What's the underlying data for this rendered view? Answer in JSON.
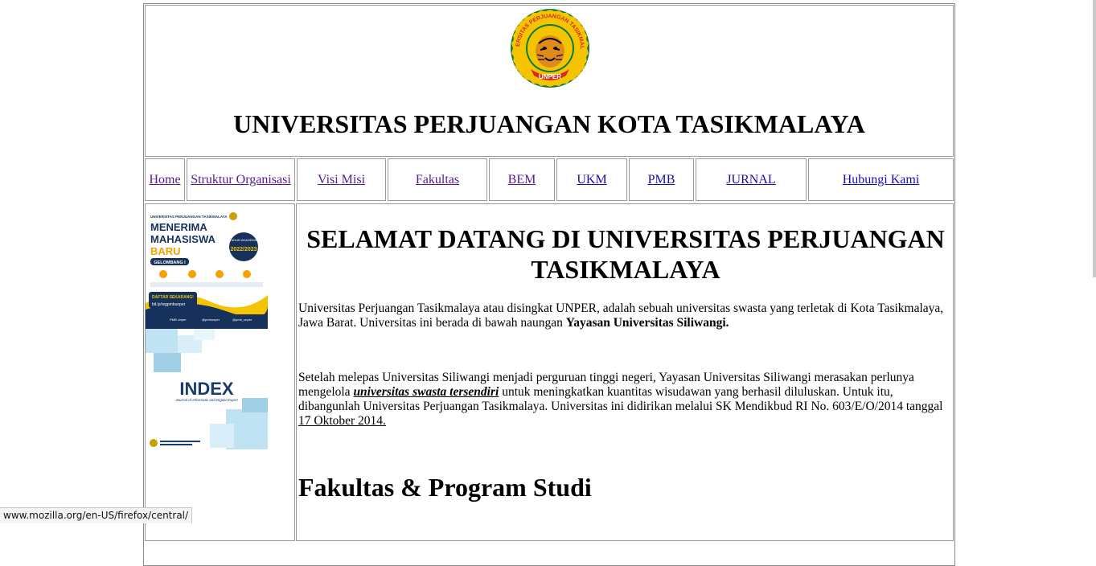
{
  "header": {
    "title": "UNIVERSITAS PERJUANGAN KOTA TASIKMALAYA",
    "logo": {
      "ring_text": "UNIVERSITAS PERJUANGAN TASIKMALAYA",
      "ribbon_text": "UNPER"
    }
  },
  "nav": {
    "items": [
      {
        "label": "Home"
      },
      {
        "label": "Struktur Organisasi"
      },
      {
        "label": "Visi Misi"
      },
      {
        "label": "Fakultas"
      },
      {
        "label": "BEM"
      },
      {
        "label": "UKM"
      },
      {
        "label": "PMB"
      },
      {
        "label": "JURNAL"
      },
      {
        "label": "Hubungi Kami"
      }
    ]
  },
  "sidebar": {
    "banner1": {
      "top_text": "UNIVERSITAS PERJUANGAN TASIKMALAYA",
      "headline": [
        "MENERIMA",
        "MAHASISWA",
        "BARU"
      ],
      "year_label": "TAHUN AKADEMIK",
      "year": "2022/2023",
      "wave": "GELOMBANG I",
      "cta": "DAFTAR SEKARANG!",
      "link": "bit.ly/regpmbunper",
      "social": [
        "PMB Unper",
        "@pmbunper",
        "@pmb_unper"
      ]
    },
    "banner2": {
      "brand": "INDEX",
      "subtitle": "Journal of Informatic and Digital Expert"
    }
  },
  "main": {
    "welcome": "SELAMAT DATANG DI UNIVERSITAS PERJUANGAN TASIKMALAYA",
    "p1_text": "Universitas Perjuangan Tasikmalaya atau disingkat UNPER, adalah sebuah universitas swasta yang terletak di Kota Tasikmalaya, Jawa Barat. Universitas ini berada di bawah naungan ",
    "p1_bold": "Yayasan Universitas Siliwangi.",
    "p2_text1": "Setelah melepas Universitas Siliwangi menjadi perguruan tinggi negeri, Yayasan Universitas Siliwangi merasakan perlunya mengelola ",
    "p2_link": "universitas swasta tersendiri",
    "p2_text2": " untuk meningkatkan kuantitas wisudawan yang berhasil diluluskan. Untuk itu, dibangunlah Universitas Perjuangan Tasikmalaya. Universitas ini didirikan melalui SK Mendikbud RI No. 603/E/O/2014 tanggal ",
    "p2_date_link": "17 Oktober 2014.",
    "section_heading": "Fakultas & Program Studi"
  },
  "status_bar": {
    "url": "www.mozilla.org/en-US/firefox/central/"
  },
  "colors": {
    "visited_link": "#551a8b",
    "link": "#1a0dab",
    "logo_yellow": "#f5c400",
    "logo_green": "#0f7a3b",
    "logo_red": "#d62a1e"
  }
}
